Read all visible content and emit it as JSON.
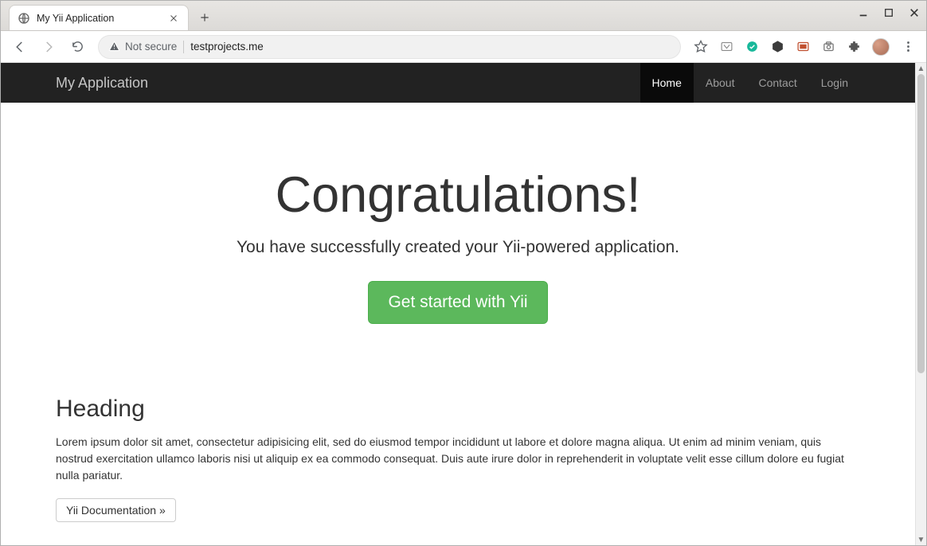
{
  "window": {
    "tab_title": "My Yii Application"
  },
  "omnibox": {
    "security_label": "Not secure",
    "url": "testprojects.me"
  },
  "navbar": {
    "brand": "My Application",
    "links": [
      {
        "label": "Home",
        "active": true
      },
      {
        "label": "About",
        "active": false
      },
      {
        "label": "Contact",
        "active": false
      },
      {
        "label": "Login",
        "active": false
      }
    ]
  },
  "jumbo": {
    "title": "Congratulations!",
    "subtitle": "You have successfully created your Yii-powered application.",
    "cta": "Get started with Yii"
  },
  "section": {
    "heading": "Heading",
    "body": "Lorem ipsum dolor sit amet, consectetur adipisicing elit, sed do eiusmod tempor incididunt ut labore et dolore magna aliqua. Ut enim ad minim veniam, quis nostrud exercitation ullamco laboris nisi ut aliquip ex ea commodo consequat. Duis aute irure dolor in reprehenderit in voluptate velit esse cillum dolore eu fugiat nulla pariatur.",
    "doc_button": "Yii Documentation »"
  }
}
